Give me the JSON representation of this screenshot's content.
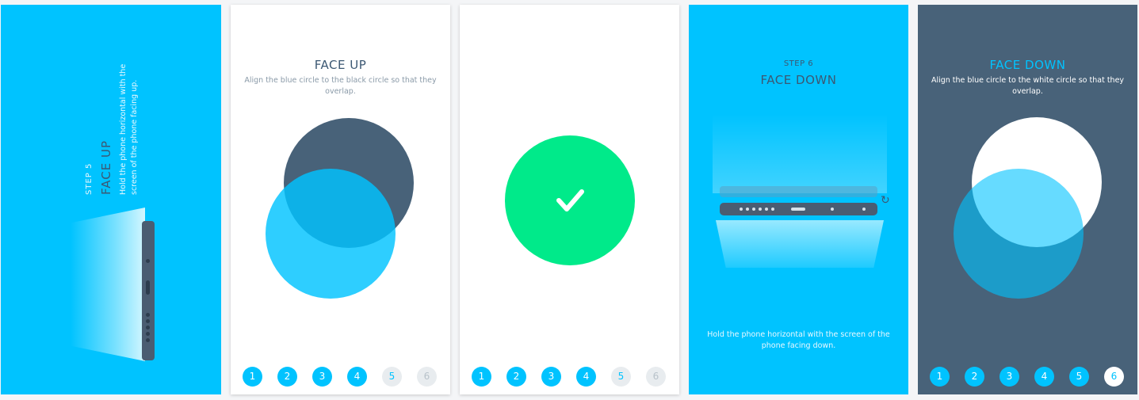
{
  "colors": {
    "accent": "#00c3ff",
    "dark": "#486279",
    "success": "#00ea8a",
    "text_dark": "#3c5873"
  },
  "screen1": {
    "step": "STEP 5",
    "title": "FACE UP",
    "description": "Hold the phone horizontal with the screen of the phone facing up."
  },
  "screen2": {
    "title": "FACE UP",
    "subtitle": "Align the blue circle to the black circle so that they overlap.",
    "steps": [
      "1",
      "2",
      "3",
      "4",
      "5",
      "6"
    ]
  },
  "screen3": {
    "check_icon": "check-icon",
    "steps": [
      "1",
      "2",
      "3",
      "4",
      "5",
      "6"
    ]
  },
  "screen4": {
    "step": "STEP 6",
    "title": "FACE DOWN",
    "description": "Hold the phone horizontal with the screen of the phone facing down."
  },
  "screen5": {
    "title": "FACE DOWN",
    "subtitle": "Align the blue circle to the white circle so that they overlap.",
    "steps": [
      "1",
      "2",
      "3",
      "4",
      "5",
      "6"
    ]
  }
}
